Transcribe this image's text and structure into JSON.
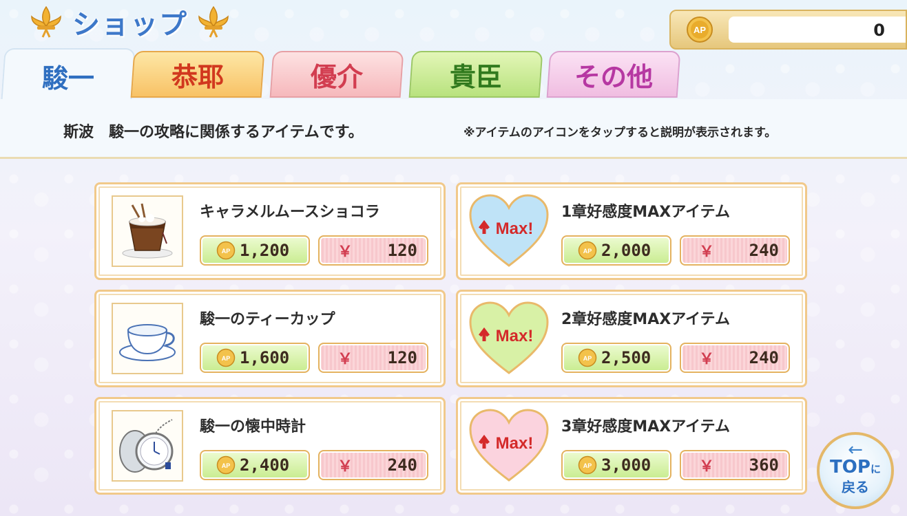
{
  "header": {
    "title": "ショップ"
  },
  "currency": {
    "icon": "ap-coin-icon",
    "value": "0"
  },
  "tabs": [
    {
      "label": "駿一",
      "active": true
    },
    {
      "label": "恭耶",
      "active": false
    },
    {
      "label": "優介",
      "active": false
    },
    {
      "label": "貴臣",
      "active": false
    },
    {
      "label": "その他",
      "active": false
    }
  ],
  "description": {
    "main": "斯波　駿一の攻略に関係するアイテムです。",
    "note": "※アイテムのアイコンをタップすると説明が表示されます。"
  },
  "items": [
    {
      "name": "キャラメルムースショコラ",
      "icon": "mousse-chocolat-icon",
      "ap_price": "1,200",
      "yen_symbol": "￥",
      "yen_price": "120"
    },
    {
      "name": "1章好感度MAXアイテム",
      "icon": "heart-max-blue-icon",
      "badge": "Max!",
      "ap_price": "2,000",
      "yen_symbol": "￥",
      "yen_price": "240"
    },
    {
      "name": "駿一のティーカップ",
      "icon": "teacup-icon",
      "ap_price": "1,600",
      "yen_symbol": "￥",
      "yen_price": "120"
    },
    {
      "name": "2章好感度MAXアイテム",
      "icon": "heart-max-green-icon",
      "badge": "Max!",
      "ap_price": "2,500",
      "yen_symbol": "￥",
      "yen_price": "240"
    },
    {
      "name": "駿一の懐中時計",
      "icon": "pocket-watch-icon",
      "ap_price": "2,400",
      "yen_symbol": "￥",
      "yen_price": "240"
    },
    {
      "name": "3章好感度MAXアイテム",
      "icon": "heart-max-pink-icon",
      "badge": "Max!",
      "ap_price": "3,000",
      "yen_symbol": "￥",
      "yen_price": "360"
    }
  ],
  "coin_label": "AP",
  "top_button": {
    "label_main": "TOP",
    "label_small": "に",
    "label_sub": "戻る"
  },
  "colors": {
    "title": "#3d78c9",
    "heart_blue": "#bfe3f7",
    "heart_green": "#d8f1a6",
    "heart_pink": "#fbd3de"
  }
}
